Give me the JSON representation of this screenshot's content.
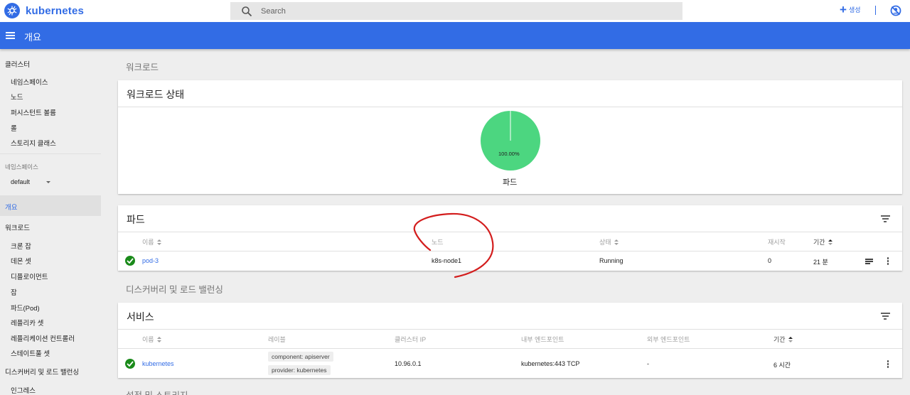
{
  "topbar": {
    "brand": "kubernetes",
    "search_placeholder": "Search",
    "create_label": "생성",
    "colors": {
      "brand": "#326ce5"
    }
  },
  "header": {
    "title": "개요"
  },
  "sidebar": {
    "cluster": "클러스터",
    "cluster_items": [
      "네임스페이스",
      "노드",
      "퍼시스턴트 볼륨",
      "롤",
      "스토리지 클래스"
    ],
    "namespace_label": "네임스페이스",
    "namespace_value": "default",
    "overview": "개요",
    "workloads": "워크로드",
    "workload_items": [
      "크론 잡",
      "데몬 셋",
      "디플로이먼트",
      "잡",
      "파드(Pod)",
      "레플리카 셋",
      "레플리케이션 컨트롤러",
      "스테이트풀 셋"
    ],
    "discovery": "디스커버리 및 로드 밸런싱",
    "discovery_items": [
      "인그레스"
    ]
  },
  "main": {
    "workloads_title": "워크로드",
    "status_card": {
      "title": "워크로드 상태",
      "pie_percent": "100.00%",
      "pie_percent_value": 100,
      "pie_label": "파드",
      "pie_color": "#4cd680"
    },
    "pods_card": {
      "title": "파드",
      "columns": [
        "이름",
        "노드",
        "상태",
        "재시작",
        "기간"
      ],
      "rows": [
        {
          "name": "pod-3",
          "node": "k8s-node1",
          "status": "Running",
          "restarts": "0",
          "age": "21 분"
        }
      ]
    },
    "discovery_title": "디스커버리 및 로드 밸런싱",
    "services_card": {
      "title": "서비스",
      "columns": [
        "이름",
        "레이블",
        "클러스터 IP",
        "내부 엔드포인트",
        "외부 엔드포인트",
        "기간"
      ],
      "rows": [
        {
          "name": "kubernetes",
          "labels": [
            "component: apiserver",
            "provider: kubernetes"
          ],
          "cluster_ip": "10.96.0.1",
          "internal_endpoint": "kubernetes:443 TCP",
          "external_endpoint": "-",
          "age": "6 시간"
        }
      ]
    },
    "next_section_title": "설정 및 스토리지"
  }
}
